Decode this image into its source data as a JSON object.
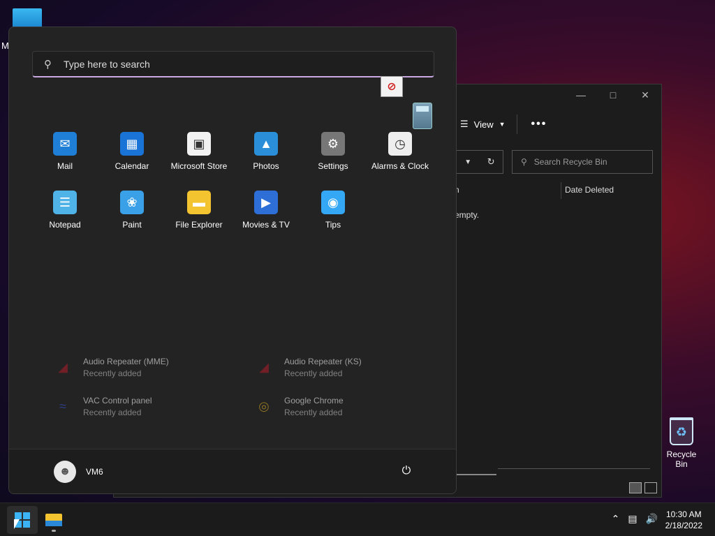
{
  "desktop": {
    "top_icon_label": "M",
    "recycle_bin_label": "Recycle Bin"
  },
  "explorer": {
    "view_label": "View",
    "more_label": "•••",
    "search_placeholder": "Search Recycle Bin",
    "col_name": "n",
    "col_date": "Date Deleted",
    "empty_message": "empty."
  },
  "start_menu": {
    "search_placeholder": "Type here to search",
    "pinned": [
      {
        "label": "Mail",
        "icon": "mail-icon",
        "color": "#1f7fd6"
      },
      {
        "label": "Calendar",
        "icon": "calendar-icon",
        "color": "#1a73d6"
      },
      {
        "label": "Microsoft Store",
        "icon": "store-icon",
        "color": "#f2f2f2"
      },
      {
        "label": "Photos",
        "icon": "photos-icon",
        "color": "#2a8fd8"
      },
      {
        "label": "Settings",
        "icon": "gear-icon",
        "color": "#777777"
      },
      {
        "label": "Alarms & Clock",
        "icon": "clock-icon",
        "color": "#eeeeee"
      },
      {
        "label": "Notepad",
        "icon": "notepad-icon",
        "color": "#4fb3e8"
      },
      {
        "label": "Paint",
        "icon": "paint-icon",
        "color": "#3aa0e8"
      },
      {
        "label": "File Explorer",
        "icon": "folder-icon",
        "color": "#f3c330"
      },
      {
        "label": "Movies & TV",
        "icon": "movies-icon",
        "color": "#2d6fd6"
      },
      {
        "label": "Tips",
        "icon": "lightbulb-icon",
        "color": "#35a8f5"
      }
    ],
    "recommended": [
      {
        "name": "Audio Repeater (MME)",
        "sub": "Recently added",
        "icon": "audio-repeater-icon"
      },
      {
        "name": "Audio Repeater (KS)",
        "sub": "Recently added",
        "icon": "audio-repeater-icon"
      },
      {
        "name": "VAC Control panel",
        "sub": "Recently added",
        "icon": "vac-icon"
      },
      {
        "name": "Google Chrome",
        "sub": "Recently added",
        "icon": "chrome-icon"
      }
    ],
    "user_name": "VM6"
  },
  "taskbar": {
    "time": "10:30 AM",
    "date": "2/18/2022"
  }
}
